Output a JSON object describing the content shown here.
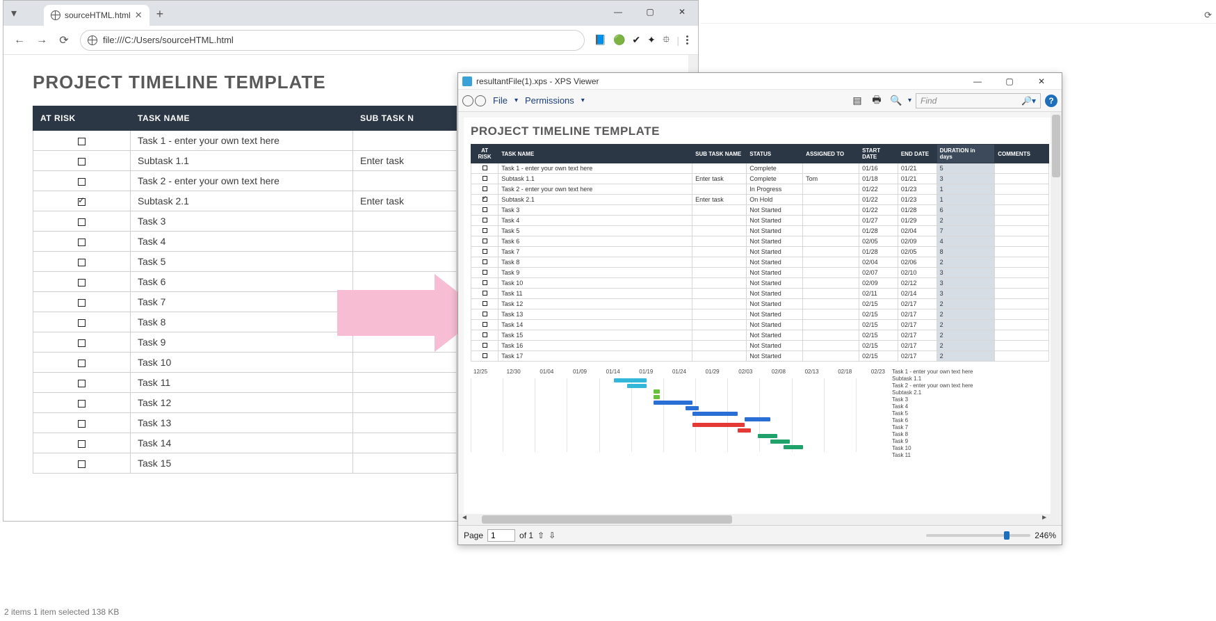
{
  "chrome": {
    "tab_title": "sourceHTML.html",
    "url": "file:///C:/Users/sourceHTML.html",
    "win": {
      "min": "—",
      "max": "▢",
      "close": "✕"
    },
    "menu_kebab": "⋮",
    "ext": {
      "a": "📘",
      "b": "🟢",
      "c": "✔",
      "d": "✦",
      "e": "⯐"
    },
    "nav": {
      "back": "←",
      "fwd": "→",
      "reload": "⟳"
    }
  },
  "xps": {
    "title": "resultantFile(1).xps - XPS Viewer",
    "menu": {
      "file": "File",
      "perm": "Permissions",
      "find_placeholder": "Find",
      "caret": "▾",
      "search": "🔍",
      "help": "?"
    },
    "status": {
      "page_label": "Page",
      "page_value": "1",
      "of": "of 1",
      "up": "⇧",
      "down": "⇩",
      "zoom": "246%",
      "left": "◄",
      "right": "►"
    },
    "win": {
      "min": "—",
      "max": "▢",
      "close": "✕"
    }
  },
  "title": "PROJECT TIMELINE TEMPLATE",
  "headers": {
    "at_risk": "AT RISK",
    "task": "TASK NAME",
    "sub": "SUB TASK NAME",
    "sub_short": "SUB TASK N",
    "status": "STATUS",
    "assigned": "ASSIGNED TO",
    "start": "START\nDATE",
    "end": "END DATE",
    "duration": "DURATION in\ndays",
    "comments": "COMMENTS"
  },
  "source_rows": [
    {
      "risk": false,
      "task": "Task 1 - enter your own text here",
      "sub": ""
    },
    {
      "risk": false,
      "task": "Subtask 1.1",
      "sub": "Enter task"
    },
    {
      "risk": false,
      "task": "Task 2 - enter your own text here",
      "sub": ""
    },
    {
      "risk": true,
      "task": "Subtask 2.1",
      "sub": "Enter task"
    },
    {
      "risk": false,
      "task": "Task 3",
      "sub": ""
    },
    {
      "risk": false,
      "task": "Task 4",
      "sub": ""
    },
    {
      "risk": false,
      "task": "Task 5",
      "sub": ""
    },
    {
      "risk": false,
      "task": "Task 6",
      "sub": ""
    },
    {
      "risk": false,
      "task": "Task 7",
      "sub": ""
    },
    {
      "risk": false,
      "task": "Task 8",
      "sub": ""
    },
    {
      "risk": false,
      "task": "Task 9",
      "sub": ""
    },
    {
      "risk": false,
      "task": "Task 10",
      "sub": ""
    },
    {
      "risk": false,
      "task": "Task 11",
      "sub": ""
    },
    {
      "risk": false,
      "task": "Task 12",
      "sub": ""
    },
    {
      "risk": false,
      "task": "Task 13",
      "sub": ""
    },
    {
      "risk": false,
      "task": "Task 14",
      "sub": ""
    },
    {
      "risk": false,
      "task": "Task 15",
      "sub": ""
    }
  ],
  "tl_rows": [
    {
      "risk": false,
      "task": "Task 1 - enter your own text here",
      "sub": "",
      "status": "Complete",
      "assigned": "",
      "start": "01/16",
      "end": "01/21",
      "dur": "5"
    },
    {
      "risk": false,
      "task": "Subtask 1.1",
      "sub": "Enter task",
      "status": "Complete",
      "assigned": "Tom",
      "start": "01/18",
      "end": "01/21",
      "dur": "3"
    },
    {
      "risk": false,
      "task": "Task 2 - enter your own text here",
      "sub": "",
      "status": "In Progress",
      "assigned": "",
      "start": "01/22",
      "end": "01/23",
      "dur": "1"
    },
    {
      "risk": true,
      "task": "Subtask 2.1",
      "sub": "Enter task",
      "status": "On Hold",
      "assigned": "",
      "start": "01/22",
      "end": "01/23",
      "dur": "1"
    },
    {
      "risk": false,
      "task": "Task 3",
      "sub": "",
      "status": "Not Started",
      "assigned": "",
      "start": "01/22",
      "end": "01/28",
      "dur": "6"
    },
    {
      "risk": false,
      "task": "Task 4",
      "sub": "",
      "status": "Not Started",
      "assigned": "",
      "start": "01/27",
      "end": "01/29",
      "dur": "2"
    },
    {
      "risk": false,
      "task": "Task 5",
      "sub": "",
      "status": "Not Started",
      "assigned": "",
      "start": "01/28",
      "end": "02/04",
      "dur": "7"
    },
    {
      "risk": false,
      "task": "Task 6",
      "sub": "",
      "status": "Not Started",
      "assigned": "",
      "start": "02/05",
      "end": "02/09",
      "dur": "4"
    },
    {
      "risk": false,
      "task": "Task 7",
      "sub": "",
      "status": "Not Started",
      "assigned": "",
      "start": "01/28",
      "end": "02/05",
      "dur": "8"
    },
    {
      "risk": false,
      "task": "Task 8",
      "sub": "",
      "status": "Not Started",
      "assigned": "",
      "start": "02/04",
      "end": "02/06",
      "dur": "2"
    },
    {
      "risk": false,
      "task": "Task 9",
      "sub": "",
      "status": "Not Started",
      "assigned": "",
      "start": "02/07",
      "end": "02/10",
      "dur": "3"
    },
    {
      "risk": false,
      "task": "Task 10",
      "sub": "",
      "status": "Not Started",
      "assigned": "",
      "start": "02/09",
      "end": "02/12",
      "dur": "3"
    },
    {
      "risk": false,
      "task": "Task 11",
      "sub": "",
      "status": "Not Started",
      "assigned": "",
      "start": "02/11",
      "end": "02/14",
      "dur": "3"
    },
    {
      "risk": false,
      "task": "Task 12",
      "sub": "",
      "status": "Not Started",
      "assigned": "",
      "start": "02/15",
      "end": "02/17",
      "dur": "2"
    },
    {
      "risk": false,
      "task": "Task 13",
      "sub": "",
      "status": "Not Started",
      "assigned": "",
      "start": "02/15",
      "end": "02/17",
      "dur": "2"
    },
    {
      "risk": false,
      "task": "Task 14",
      "sub": "",
      "status": "Not Started",
      "assigned": "",
      "start": "02/15",
      "end": "02/17",
      "dur": "2"
    },
    {
      "risk": false,
      "task": "Task 15",
      "sub": "",
      "status": "Not Started",
      "assigned": "",
      "start": "02/15",
      "end": "02/17",
      "dur": "2"
    },
    {
      "risk": false,
      "task": "Task 16",
      "sub": "",
      "status": "Not Started",
      "assigned": "",
      "start": "02/15",
      "end": "02/17",
      "dur": "2"
    },
    {
      "risk": false,
      "task": "Task 17",
      "sub": "",
      "status": "Not Started",
      "assigned": "",
      "start": "02/15",
      "end": "02/17",
      "dur": "2"
    }
  ],
  "chart_data": {
    "type": "bar",
    "orientation": "horizontal-gantt",
    "x_ticks": [
      "12/25",
      "12/30",
      "01/04",
      "01/09",
      "01/14",
      "01/19",
      "01/24",
      "01/29",
      "02/03",
      "02/08",
      "02/13",
      "02/18",
      "02/23"
    ],
    "x_range": [
      "12/25",
      "02/27"
    ],
    "series": [
      {
        "name": "Task 1 - enter your own text here",
        "start": "01/16",
        "end": "01/21",
        "color": "#34b8d9"
      },
      {
        "name": "Subtask 1.1",
        "start": "01/18",
        "end": "01/21",
        "color": "#34b8d9"
      },
      {
        "name": "Task 2 - enter your own text here",
        "start": "01/22",
        "end": "01/23",
        "color": "#67c23a"
      },
      {
        "name": "Subtask 2.1",
        "start": "01/22",
        "end": "01/23",
        "color": "#67c23a"
      },
      {
        "name": "Task 3",
        "start": "01/22",
        "end": "01/28",
        "color": "#2a6fd6"
      },
      {
        "name": "Task 4",
        "start": "01/27",
        "end": "01/29",
        "color": "#2a6fd6"
      },
      {
        "name": "Task 5",
        "start": "01/28",
        "end": "02/04",
        "color": "#2a6fd6"
      },
      {
        "name": "Task 6",
        "start": "02/05",
        "end": "02/09",
        "color": "#2a6fd6"
      },
      {
        "name": "Task 7",
        "start": "01/28",
        "end": "02/05",
        "color": "#e53935"
      },
      {
        "name": "Task 8",
        "start": "02/04",
        "end": "02/06",
        "color": "#e53935"
      },
      {
        "name": "Task 9",
        "start": "02/07",
        "end": "02/10",
        "color": "#1fa36a"
      },
      {
        "name": "Task 10",
        "start": "02/09",
        "end": "02/12",
        "color": "#1fa36a"
      },
      {
        "name": "Task 11",
        "start": "02/11",
        "end": "02/14",
        "color": "#1fa36a"
      }
    ],
    "legend": [
      "Task 1 - enter your own text here",
      "Subtask 1.1",
      "Task 2 - enter your own text here",
      "Subtask 2.1",
      "Task 3",
      "Task 4",
      "Task 5",
      "Task 6",
      "Task 7",
      "Task 8",
      "Task 9",
      "Task 10",
      "Task 11"
    ]
  },
  "footer": "2 items   1 item selected  138 KB"
}
